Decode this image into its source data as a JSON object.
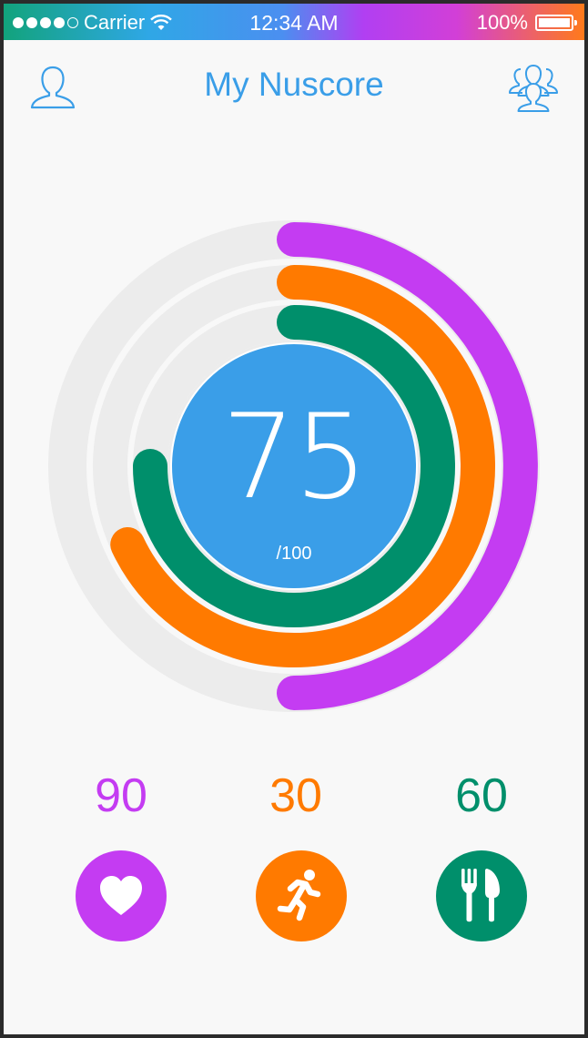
{
  "status_bar": {
    "carrier": "Carrier",
    "time": "12:34 AM",
    "battery": "100%"
  },
  "header": {
    "title": "My Nuscore",
    "left_icon": "profile-icon",
    "right_icon": "group-icon"
  },
  "score": {
    "value": "75",
    "max": "/100"
  },
  "colors": {
    "accent_blue": "#3a9ee8",
    "heart_purple": "#c43cf2",
    "activity_orange": "#ff7a00",
    "nutrition_green": "#008f6b",
    "track_gray": "#ececec"
  },
  "metrics": [
    {
      "name": "heart",
      "value": "90",
      "icon": "heart-icon",
      "color": "#c43cf2",
      "fraction": 0.5
    },
    {
      "name": "activity",
      "value": "30",
      "icon": "running-person-icon",
      "color": "#ff7a00",
      "fraction": 0.68
    },
    {
      "name": "nutrition",
      "value": "60",
      "icon": "fork-knife-icon",
      "color": "#008f6b",
      "fraction": 0.75
    }
  ]
}
